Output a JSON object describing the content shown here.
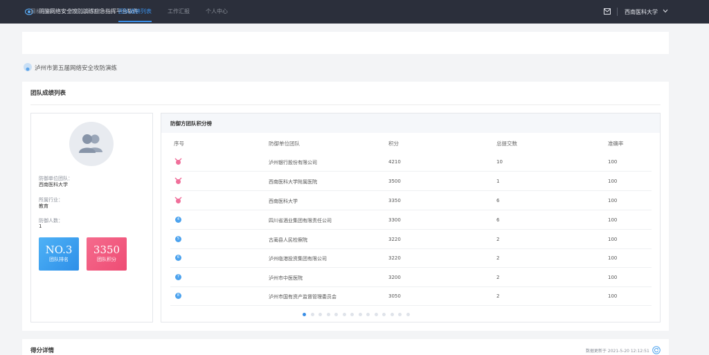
{
  "app": {
    "title": "明鉴网络安全攻防演练应急指挥平台软件"
  },
  "user": {
    "name": "西南医科大学"
  },
  "nav": {
    "tabs": [
      {
        "label": "目标系统"
      },
      {
        "label": "防御成果列表"
      },
      {
        "label": "团队成绩列表"
      },
      {
        "label": "工作汇报"
      },
      {
        "label": "个人中心"
      }
    ],
    "active_tab": "团队成绩列表"
  },
  "drill": {
    "title": "泸州市第五届网络安全攻防演练"
  },
  "section": {
    "title": "团队成绩列表"
  },
  "team": {
    "unit_label": "防御单位团队：",
    "unit_value": "西南医科大学",
    "industry_label": "所属行业：",
    "industry_value": "教育",
    "members_label": "防御人数：",
    "members_value": "1",
    "rank_value": "NO.3",
    "rank_caption": "团队排名",
    "score_value": "3350",
    "score_caption": "团队积分"
  },
  "ranking": {
    "title": "防御方团队积分榜",
    "columns": [
      "序号",
      "防御单位团队",
      "积分",
      "总提交数",
      "准确率"
    ],
    "rows": [
      {
        "rank": "1",
        "team": "泸州银行股份有限公司",
        "score": "4210",
        "submissions": "10",
        "accuracy": "100"
      },
      {
        "rank": "2",
        "team": "西南医科大学附属医院",
        "score": "3500",
        "submissions": "1",
        "accuracy": "100"
      },
      {
        "rank": "3",
        "team": "西南医科大学",
        "score": "3350",
        "submissions": "6",
        "accuracy": "100"
      },
      {
        "rank": "4",
        "team": "四川省酒业集团有限责任公司",
        "score": "3300",
        "submissions": "6",
        "accuracy": "100"
      },
      {
        "rank": "5",
        "team": "古蔺县人民检察院",
        "score": "3220",
        "submissions": "2",
        "accuracy": "100"
      },
      {
        "rank": "6",
        "team": "泸州临港投资集团有限公司",
        "score": "3220",
        "submissions": "2",
        "accuracy": "100"
      },
      {
        "rank": "7",
        "team": "泸州市中医医院",
        "score": "3200",
        "submissions": "2",
        "accuracy": "100"
      },
      {
        "rank": "8",
        "team": "泸州市国有资产监督管理委员会",
        "score": "3050",
        "submissions": "2",
        "accuracy": "100"
      }
    ],
    "pagination": {
      "pages": 14,
      "current": 1
    }
  },
  "detail": {
    "title": "得分详情",
    "update_text": "数据更新于 2021-5-20 12:12:51"
  },
  "icons": {
    "logo": "shield-logo-icon",
    "mail": "mail-icon",
    "caret": "chevron-down-icon",
    "drill": "drill-badge-icon",
    "avatar": "users-icon",
    "medal": "medal-icon",
    "refresh": "refresh-icon"
  },
  "colors": {
    "topbar": "#2b2f3b",
    "accent": "#3a8ee6",
    "rank_box": "#2d8fe8",
    "score_box": "#ee4c74",
    "medal": "#f06f9a"
  }
}
